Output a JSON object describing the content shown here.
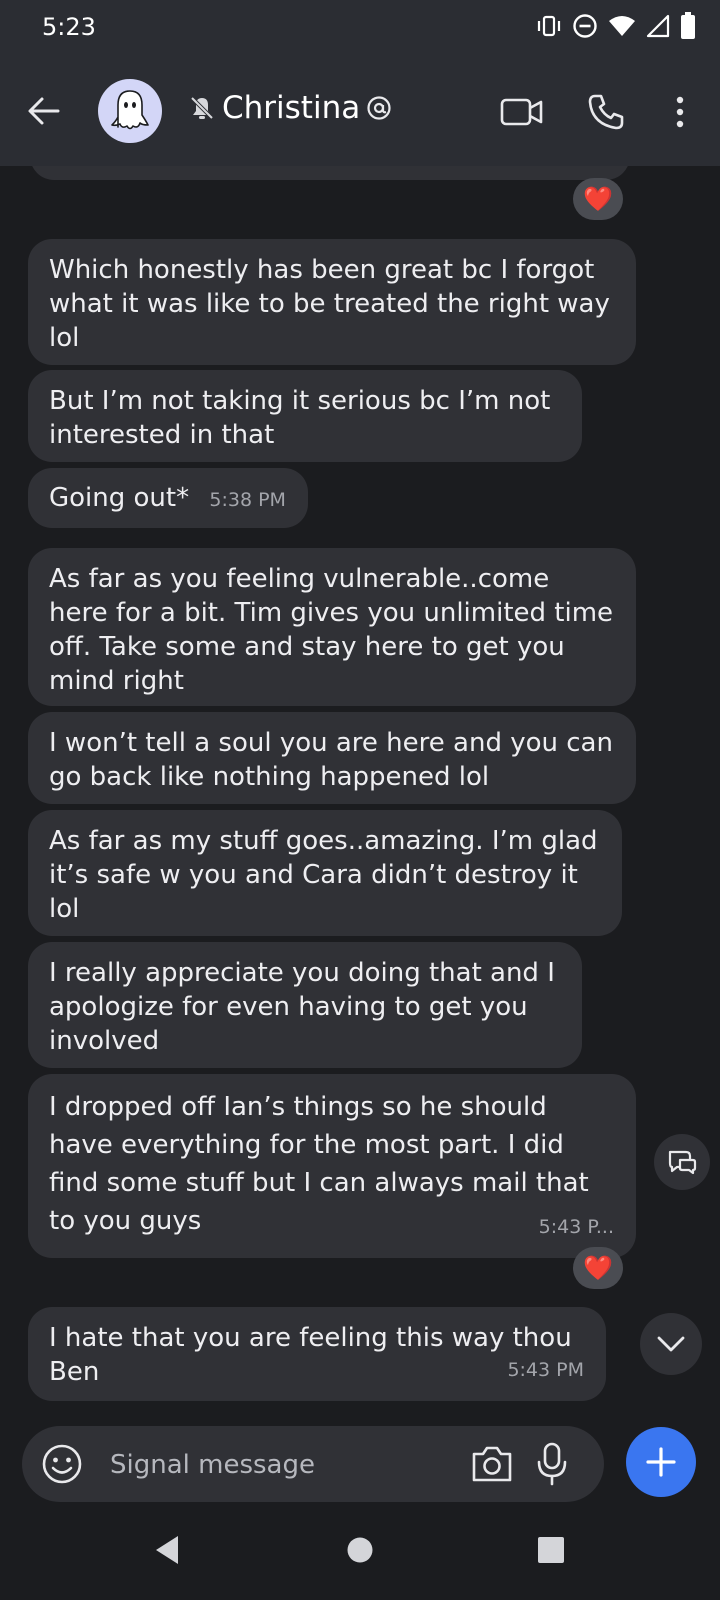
{
  "status_bar": {
    "time": "5:23"
  },
  "header": {
    "contact_name": "Christina"
  },
  "messages": [
    {
      "text": "Which honestly has been great bc I forgot what it was like to be treated the right way lol"
    },
    {
      "text": "But I’m not taking it serious bc I’m not interested in that"
    },
    {
      "text": "Going out*",
      "time": "5:38 PM"
    },
    {
      "text": "As far as you feeling vulnerable..come here for a bit. Tim gives you unlimited time off. Take some and stay here to get you mind right"
    },
    {
      "text": "I won’t tell a soul you are here and you can go back like nothing happened lol"
    },
    {
      "text": "As far as my stuff goes..amazing. I’m glad it’s safe w you and Cara didn’t destroy it lol"
    },
    {
      "text": "I really appreciate you doing that and I apologize for even having to get you involved"
    },
    {
      "text": "I dropped off Ian’s things so he should have everything for the most part. I did find some stuff but I can always mail that to you guys",
      "time": "5:43 P..."
    },
    {
      "text": "I hate that you are feeling this way thou Ben",
      "time": "5:43 PM"
    }
  ],
  "reactions": {
    "heart": "❤️"
  },
  "composer": {
    "placeholder": "Signal message"
  },
  "colors": {
    "accent": "#3a76f0",
    "bubble": "#303136",
    "header": "#2b2d33",
    "background": "#1b1c1f"
  },
  "icons": [
    "back-arrow-icon",
    "ghost-avatar-icon",
    "muted-bell-icon",
    "mention-icon",
    "video-call-icon",
    "phone-icon",
    "more-vert-icon",
    "emoji-icon",
    "camera-icon",
    "mic-icon",
    "plus-icon",
    "quote-reply-icon",
    "chevron-down-icon",
    "nav-back-icon",
    "nav-home-icon",
    "nav-recents-icon"
  ]
}
